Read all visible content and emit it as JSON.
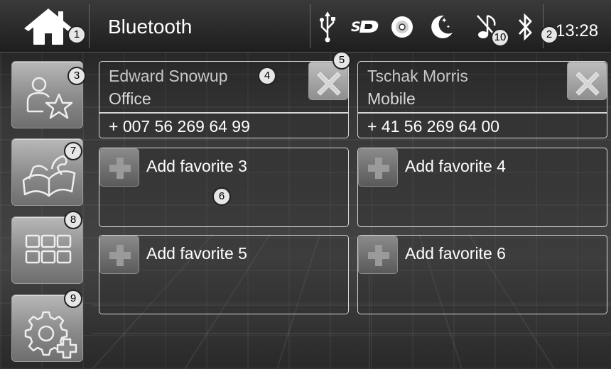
{
  "header": {
    "title": "Bluetooth",
    "clock": "13:28",
    "status_icons": [
      "usb-icon",
      "sd-card-icon",
      "disc-icon",
      "night-mode-icon",
      "music-off-icon",
      "bluetooth-icon"
    ]
  },
  "nav": {
    "home_icon": "home-icon",
    "items": [
      {
        "icon": "contacts-favorites-icon"
      },
      {
        "icon": "phonebook-icon"
      },
      {
        "icon": "keypad-icon"
      },
      {
        "icon": "settings-add-icon"
      }
    ]
  },
  "favorites": {
    "contacts": [
      {
        "name": "Edward Snowup",
        "type": "Office",
        "number": "+ 007 56 269 64 99"
      },
      {
        "name": "Tschak Morris",
        "type": "Mobile",
        "number": "+ 41 56 269 64 00"
      }
    ],
    "empty_slots": [
      {
        "label": "Add favorite 3"
      },
      {
        "label": "Add favorite 4"
      },
      {
        "label": "Add favorite 5"
      },
      {
        "label": "Add favorite 6"
      }
    ]
  },
  "callouts": {
    "c1": "1",
    "c2": "2",
    "c3": "3",
    "c4": "4",
    "c5": "5",
    "c6": "6",
    "c7": "7",
    "c8": "8",
    "c9": "9",
    "c10": "10"
  },
  "colors": {
    "background": "#3a3a3a",
    "card_border": "#d8d8d8",
    "button_gray": "#9a9a9a",
    "text": "#ffffff"
  }
}
